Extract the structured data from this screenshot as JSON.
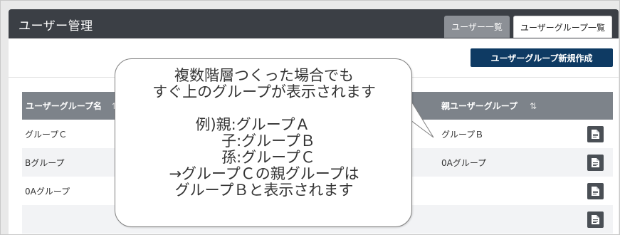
{
  "header": {
    "title": "ユーザー管理",
    "tabs": [
      {
        "label": "ユーザー一覧",
        "active": false
      },
      {
        "label": "ユーザーグループ一覧",
        "active": true
      }
    ]
  },
  "toolbar": {
    "create_label": "ユーザーグループ新規作成"
  },
  "table": {
    "columns": [
      "ユーザーグループ名",
      "親ユーザーグループ"
    ],
    "sort_icon": "⇅",
    "rows": [
      {
        "name": "グループＣ",
        "parent": "グループＢ"
      },
      {
        "name": "Bグループ",
        "parent": "0Aグループ"
      },
      {
        "name": "0Aグループ",
        "parent": ""
      },
      {
        "name": "",
        "parent": ""
      }
    ]
  },
  "callout": {
    "line1": "複数階層つくった場合でも",
    "line2": "すぐ上のグループが表示されます",
    "ex1": "例)親:グループＡ",
    "ex2": "子:グループＢ",
    "ex3": "孫:グループＣ",
    "ex4": "→グループＣの親グループは",
    "ex5": "グループＢと表示されます"
  },
  "colors": {
    "header_bg": "#3b3f45",
    "accent_button": "#0e3a63",
    "table_header_bg": "#7d838a"
  }
}
